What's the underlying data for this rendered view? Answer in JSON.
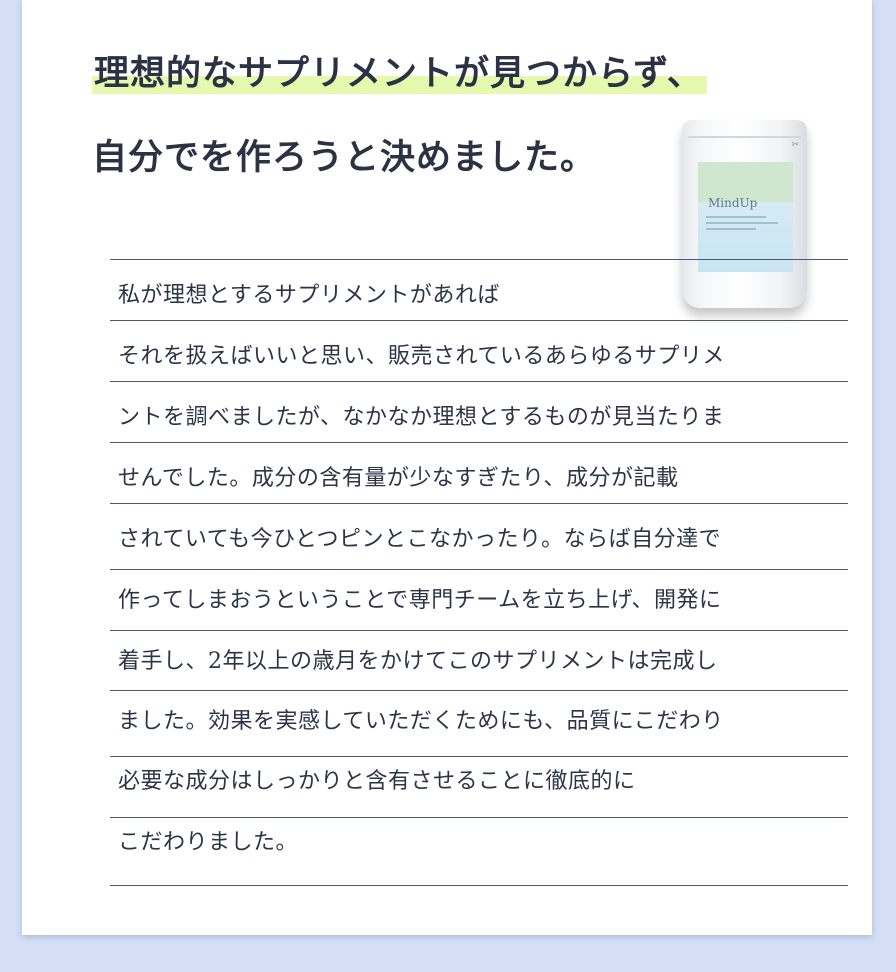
{
  "headline": {
    "line1": "理想的なサプリメントが見つからず、",
    "line2": "自分でを作ろうと決めました。"
  },
  "product": {
    "brand": "MindUp",
    "icon": "supplement-pouch-icon"
  },
  "body_lines": [
    "私が理想とするサプリメントがあれば",
    "それを扱えばいいと思い、販売されているあらゆるサプリメ",
    "ントを調べましたが、なかなか理想とするものが見当たりま",
    "せんでした。成分の含有量が少なすぎたり、成分が記載",
    "されていても今ひとつピンとこなかったり。ならば自分達で",
    "作ってしまおうということで専門チームを立ち上げ、開発に",
    "着手し、2年以上の歳月をかけてこのサプリメントは完成し",
    "ました。効果を実感していただくためにも、品質にこだわり",
    "必要な成分はしっかりと含有させることに徹底的に",
    "こだわりました。"
  ],
  "colors": {
    "background": "#d4dff6",
    "card": "#ffffff",
    "highlight": "#e6f9ae",
    "rule": "#4c5972",
    "text": "#2d3446"
  }
}
